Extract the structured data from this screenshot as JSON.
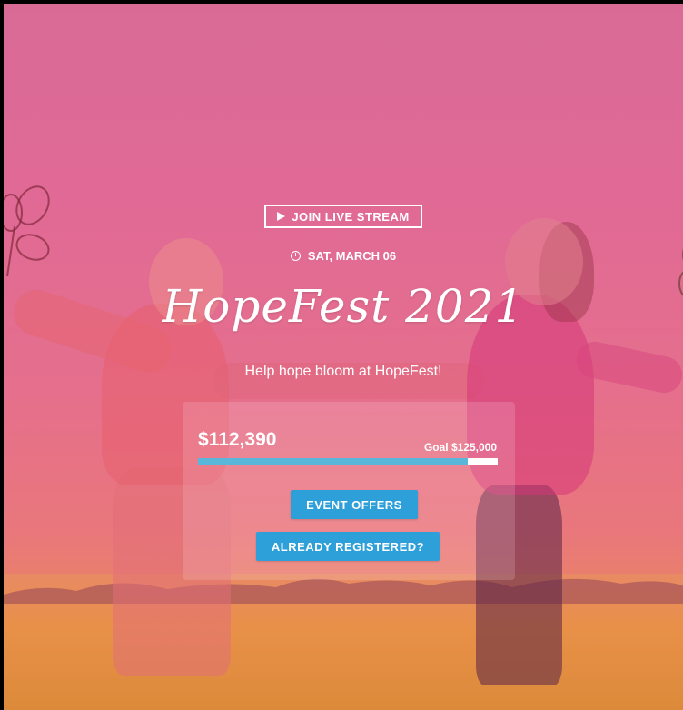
{
  "stream_button": {
    "label": "JOIN LIVE STREAM",
    "icon": "play-icon"
  },
  "event": {
    "date": "SAT, MARCH 06",
    "date_icon": "clock-icon",
    "title": "HopeFest 2021",
    "tagline": "Help hope bloom at HopeFest!"
  },
  "fundraiser": {
    "raised_label": "$112,390",
    "goal_label": "Goal $125,000",
    "raised_amount": 112390,
    "goal_amount": 125000,
    "progress_color": "#5bb7da"
  },
  "buttons": {
    "event_offers": "EVENT OFFERS",
    "already_registered": "ALREADY REGISTERED?",
    "color": "#2d9fd9"
  }
}
